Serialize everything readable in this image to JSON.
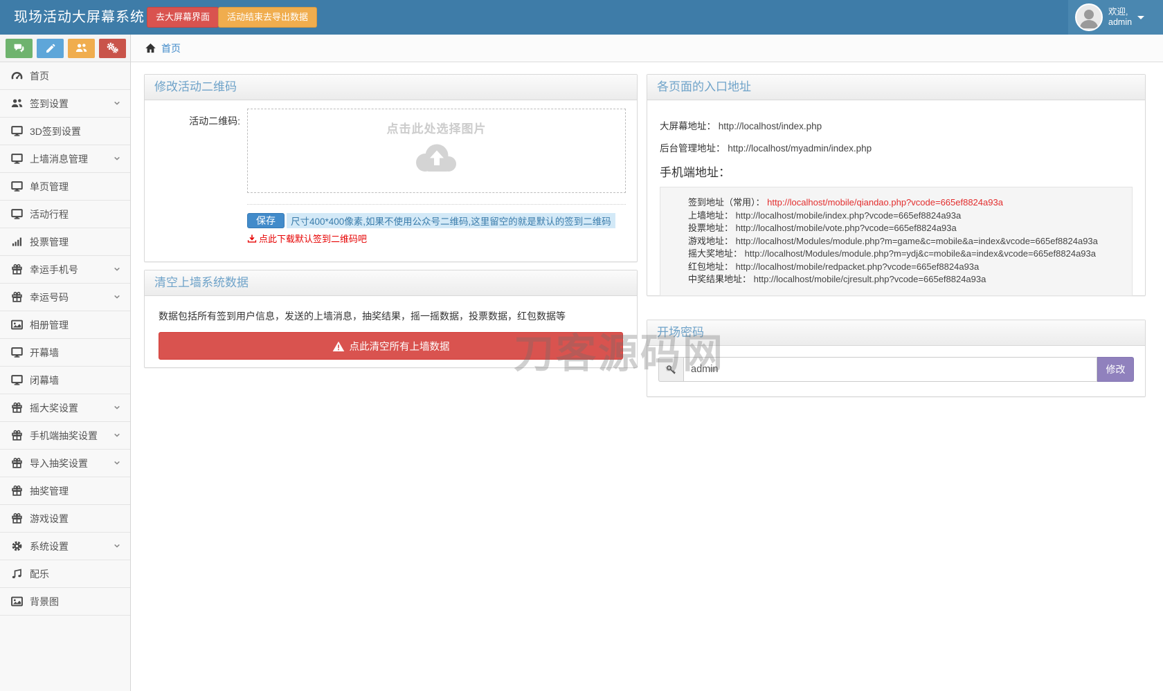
{
  "navbar": {
    "title": "现场活动大屏幕系统",
    "btn_screen": "去大屏幕界面",
    "btn_export": "活动结束去导出数据",
    "welcome_line1": "欢迎,",
    "welcome_line2": "admin"
  },
  "breadcrumb": {
    "home": "首页"
  },
  "toolbar_icons": [
    "comments-icon",
    "pencil-icon",
    "users-icon",
    "cogs-icon"
  ],
  "sidebar": {
    "items": [
      {
        "label": "首页",
        "icon": "dashboard-icon",
        "expandable": false
      },
      {
        "label": "签到设置",
        "icon": "users-icon",
        "expandable": true
      },
      {
        "label": "3D签到设置",
        "icon": "desktop-icon",
        "expandable": false
      },
      {
        "label": "上墙消息管理",
        "icon": "desktop-icon",
        "expandable": true
      },
      {
        "label": "单页管理",
        "icon": "desktop-icon",
        "expandable": false
      },
      {
        "label": "活动行程",
        "icon": "desktop-icon",
        "expandable": false
      },
      {
        "label": "投票管理",
        "icon": "signal-icon",
        "expandable": false
      },
      {
        "label": "幸运手机号",
        "icon": "gift-icon",
        "expandable": true
      },
      {
        "label": "幸运号码",
        "icon": "gift-icon",
        "expandable": true
      },
      {
        "label": "相册管理",
        "icon": "image-icon",
        "expandable": false
      },
      {
        "label": "开幕墙",
        "icon": "desktop-icon",
        "expandable": false
      },
      {
        "label": "闭幕墙",
        "icon": "desktop-icon",
        "expandable": false
      },
      {
        "label": "摇大奖设置",
        "icon": "gift-icon",
        "expandable": true
      },
      {
        "label": "手机端抽奖设置",
        "icon": "gift-icon",
        "expandable": true
      },
      {
        "label": "导入抽奖设置",
        "icon": "gift-icon",
        "expandable": true
      },
      {
        "label": "抽奖管理",
        "icon": "gift-icon",
        "expandable": false
      },
      {
        "label": "游戏设置",
        "icon": "gift-icon",
        "expandable": false
      },
      {
        "label": "系统设置",
        "icon": "gear-icon",
        "expandable": true
      },
      {
        "label": "配乐",
        "icon": "music-icon",
        "expandable": false
      },
      {
        "label": "背景图",
        "icon": "image-icon",
        "expandable": false
      }
    ]
  },
  "qr_panel": {
    "title": "修改活动二维码",
    "field_label": "活动二维码:",
    "upload_text": "点击此处选择图片",
    "save_label": "保存",
    "save_hint": "尺寸400*400像素,如果不使用公众号二维码,这里留空的就是默认的签到二维码",
    "download_link": "点此下载默认签到二维码吧"
  },
  "clear_panel": {
    "title": "清空上墙系统数据",
    "description": "数据包括所有签到用户信息，发送的上墙消息，抽奖结果，摇一摇数据，投票数据，红包数据等",
    "button_label": "点此清空所有上墙数据"
  },
  "entry_panel": {
    "title": "各页面的入口地址",
    "screen_label": "大屏幕地址：",
    "screen_url": "http://localhost/index.php",
    "admin_label": "后台管理地址：",
    "admin_url": "http://localhost/myadmin/index.php",
    "mobile_heading": "手机端地址：",
    "mobile": [
      {
        "label": "签到地址（常用）：",
        "url": "http://localhost/mobile/qiandao.php?vcode=665ef8824a93a"
      },
      {
        "label": "上墙地址：",
        "url": "http://localhost/mobile/index.php?vcode=665ef8824a93a"
      },
      {
        "label": "投票地址：",
        "url": "http://localhost/mobile/vote.php?vcode=665ef8824a93a"
      },
      {
        "label": "游戏地址：",
        "url": "http://localhost/Modules/module.php?m=game&c=mobile&a=index&vcode=665ef8824a93a"
      },
      {
        "label": "摇大奖地址：",
        "url": "http://localhost/Modules/module.php?m=ydj&c=mobile&a=index&vcode=665ef8824a93a"
      },
      {
        "label": "红包地址：",
        "url": "http://localhost/mobile/redpacket.php?vcode=665ef8824a93a"
      },
      {
        "label": "中奖结果地址：",
        "url": "http://localhost/mobile/cjresult.php?vcode=665ef8824a93a"
      }
    ]
  },
  "password_panel": {
    "title": "开场密码",
    "input_value": "admin",
    "button_label": "修改"
  },
  "watermark": "刀客源码网",
  "colors": {
    "navbar": "#3e7ca8",
    "danger": "#d9534f",
    "warning": "#f0ad4e",
    "primary": "#428bca",
    "purple": "#9081bd"
  }
}
